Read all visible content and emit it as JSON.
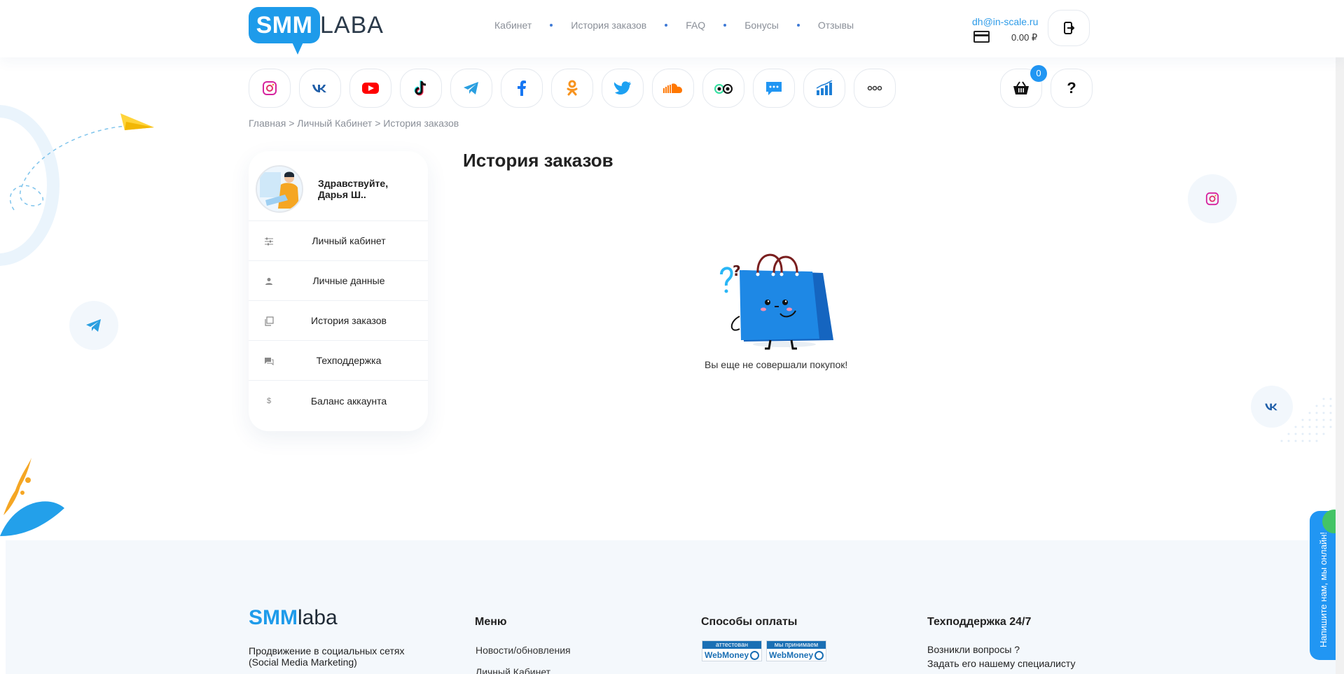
{
  "header": {
    "logo_part1": "SMM",
    "logo_part2": "LABA",
    "nav": [
      "Кабинет",
      "История заказов",
      "FAQ",
      "Бонусы",
      "Отзывы"
    ],
    "account_email": "dh@in-scale.ru",
    "balance": "0.00 ₽",
    "icons": {
      "card": "credit-card-icon",
      "logout": "logout-icon"
    }
  },
  "social": {
    "items": [
      {
        "name": "instagram",
        "icon": "instagram-icon",
        "color": "#d6249f"
      },
      {
        "name": "vk",
        "icon": "vk-icon",
        "color": "#1f5ea8"
      },
      {
        "name": "youtube",
        "icon": "youtube-icon",
        "color": "#ff0000"
      },
      {
        "name": "tiktok",
        "icon": "tiktok-icon",
        "color": "#111111"
      },
      {
        "name": "telegram",
        "icon": "telegram-icon",
        "color": "#2a9fe0"
      },
      {
        "name": "facebook",
        "icon": "facebook-icon",
        "color": "#1877f2"
      },
      {
        "name": "odnoklassniki",
        "icon": "odnoklassniki-icon",
        "color": "#f7931e"
      },
      {
        "name": "twitter",
        "icon": "twitter-icon",
        "color": "#1da1f2"
      },
      {
        "name": "soundcloud",
        "icon": "soundcloud-icon",
        "color": "#ff7700"
      },
      {
        "name": "tripadvisor",
        "icon": "tripadvisor-icon",
        "color": "#34e0a1"
      },
      {
        "name": "chat",
        "icon": "message-icon",
        "color": "#2196f3"
      },
      {
        "name": "stats",
        "icon": "bar-chart-icon",
        "color": "#1e7fd6"
      },
      {
        "name": "more",
        "icon": "more-icon",
        "color": "#333333"
      }
    ],
    "cart_count": "0",
    "help_label": "?"
  },
  "breadcrumb": {
    "home": "Главная",
    "sep": ">",
    "cabinet": "Личный Кабинет",
    "current": "История заказов"
  },
  "sidebar": {
    "greeting_line1": "Здравствуйте,",
    "greeting_line2": "Дарья Ш..",
    "items": [
      {
        "label": "Личный кабинет",
        "icon": "sliders-icon"
      },
      {
        "label": "Личные данные",
        "icon": "person-icon"
      },
      {
        "label": "История заказов",
        "icon": "copy-icon"
      },
      {
        "label": "Техподдержка",
        "icon": "chat-bubble-icon"
      },
      {
        "label": "Баланс аккаунта",
        "icon": "dollar-icon"
      }
    ]
  },
  "main": {
    "title": "История заказов",
    "empty_text": "Вы еще не совершали покупок!"
  },
  "footer": {
    "logo_bold": "SMM",
    "logo_light": "laba",
    "desc_line1": "Продвижение в социальных сетях",
    "desc_line2": "(Social Media Marketing)",
    "menu_title": "Меню",
    "menu_links": [
      "Новости/обновления",
      "Личный Кабинет"
    ],
    "payment_title": "Способы оплаты",
    "wm_badges": [
      {
        "top": "аттестован",
        "bottom": "WebMoney"
      },
      {
        "top": "мы принимаем",
        "bottom": "WebMoney"
      }
    ],
    "support_title": "Техподдержка 24/7",
    "support_line1": "Возникли вопросы ?",
    "support_line2": "Задать его нашему специалисту"
  },
  "chat_widget": {
    "label": "Напишите нам, мы онлайн!"
  }
}
